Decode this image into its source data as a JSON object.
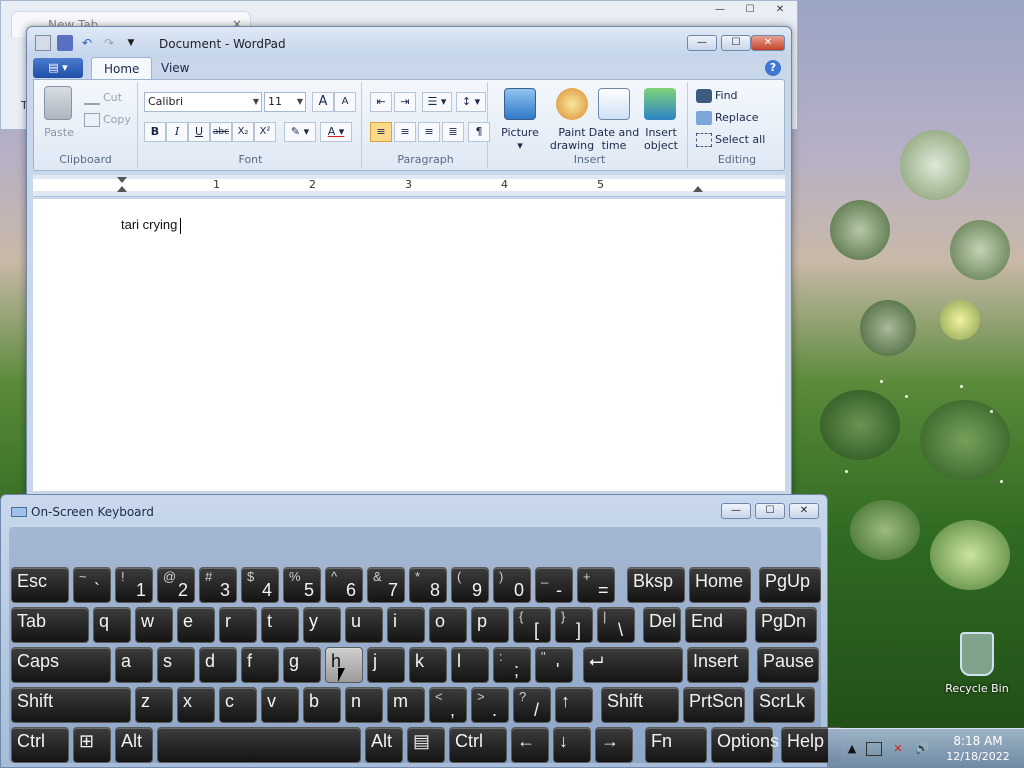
{
  "browser": {
    "tab_title": "New Tab",
    "tab_close": "×",
    "left_char": "T",
    "min": "—",
    "max": "☐",
    "close": "✕"
  },
  "wordpad": {
    "title": "Document - WordPad",
    "controls": {
      "min": "—",
      "max": "☐",
      "close": "✕"
    },
    "tabs": [
      "Home",
      "View"
    ],
    "help": "?",
    "clipboard": {
      "paste": "Paste",
      "cut": "Cut",
      "copy": "Copy",
      "group": "Clipboard"
    },
    "font": {
      "name": "Calibri",
      "size": "11",
      "group": "Font",
      "grow": "A",
      "shrink": "A",
      "bold": "B",
      "italic": "I",
      "underline": "U",
      "strike": "abc",
      "sub": "X₂",
      "sup": "X²"
    },
    "paragraph": {
      "group": "Paragraph"
    },
    "insert": {
      "picture": "Picture",
      "paint": "Paint drawing",
      "datetime": "Date and time",
      "object": "Insert object",
      "group": "Insert"
    },
    "editing": {
      "find": "Find",
      "replace": "Replace",
      "select_all": "Select all",
      "group": "Editing"
    },
    "ruler": [
      "1",
      "2",
      "3",
      "4",
      "5"
    ],
    "document_text": "tari crying"
  },
  "osk": {
    "title": "On-Screen Keyboard",
    "controls": {
      "min": "—",
      "max": "☐",
      "close": "✕"
    },
    "rows": [
      [
        {
          "main": "Esc"
        },
        {
          "sub": "~",
          "low": "`"
        },
        {
          "sub": "!",
          "low": "1"
        },
        {
          "sub": "@",
          "low": "2"
        },
        {
          "sub": "#",
          "low": "3"
        },
        {
          "sub": "$",
          "low": "4"
        },
        {
          "sub": "%",
          "low": "5"
        },
        {
          "sub": "^",
          "low": "6"
        },
        {
          "sub": "&",
          "low": "7"
        },
        {
          "sub": "*",
          "low": "8"
        },
        {
          "sub": "(",
          "low": "9"
        },
        {
          "sub": ")",
          "low": "0"
        },
        {
          "sub": "_",
          "low": "-"
        },
        {
          "sub": "+",
          "low": "="
        },
        {
          "main": "Bksp"
        },
        {
          "main": "Home"
        },
        {
          "main": "PgUp"
        }
      ],
      [
        {
          "main": "Tab"
        },
        {
          "main": "q"
        },
        {
          "main": "w"
        },
        {
          "main": "e"
        },
        {
          "main": "r"
        },
        {
          "main": "t"
        },
        {
          "main": "y"
        },
        {
          "main": "u"
        },
        {
          "main": "i"
        },
        {
          "main": "o"
        },
        {
          "main": "p"
        },
        {
          "sub": "{",
          "low": "["
        },
        {
          "sub": "}",
          "low": "]"
        },
        {
          "sub": "|",
          "low": "\\"
        },
        {
          "main": "Del"
        },
        {
          "main": "End"
        },
        {
          "main": "PgDn"
        }
      ],
      [
        {
          "main": "Caps"
        },
        {
          "main": "a"
        },
        {
          "main": "s"
        },
        {
          "main": "d"
        },
        {
          "main": "f"
        },
        {
          "main": "g"
        },
        {
          "main": "h"
        },
        {
          "main": "j"
        },
        {
          "main": "k"
        },
        {
          "main": "l"
        },
        {
          "sub": ":",
          "low": ";"
        },
        {
          "sub": "\"",
          "low": "'"
        },
        {
          "main": "⮠"
        },
        {
          "main": "Insert"
        },
        {
          "main": "Pause"
        }
      ],
      [
        {
          "main": "Shift"
        },
        {
          "main": "z"
        },
        {
          "main": "x"
        },
        {
          "main": "c"
        },
        {
          "main": "v"
        },
        {
          "main": "b"
        },
        {
          "main": "n"
        },
        {
          "main": "m"
        },
        {
          "sub": "<",
          "low": ","
        },
        {
          "sub": ">",
          "low": "."
        },
        {
          "sub": "?",
          "low": "/"
        },
        {
          "main": "↑"
        },
        {
          "main": "Shift"
        },
        {
          "main": "PrtScn"
        },
        {
          "main": "ScrLk"
        }
      ],
      [
        {
          "main": "Ctrl"
        },
        {
          "main": "⊞"
        },
        {
          "main": "Alt"
        },
        {
          "main": ""
        },
        {
          "main": "Alt"
        },
        {
          "main": "▤"
        },
        {
          "main": "Ctrl"
        },
        {
          "main": "←"
        },
        {
          "main": "↓"
        },
        {
          "main": "→"
        },
        {
          "main": "Fn"
        },
        {
          "main": "Options"
        },
        {
          "main": "Help"
        }
      ]
    ]
  },
  "taskbar": {
    "time": "8:18 AM",
    "date": "12/18/2022",
    "show_hidden": "▲"
  },
  "desktop": {
    "recycle_bin": "Recycle Bin"
  }
}
